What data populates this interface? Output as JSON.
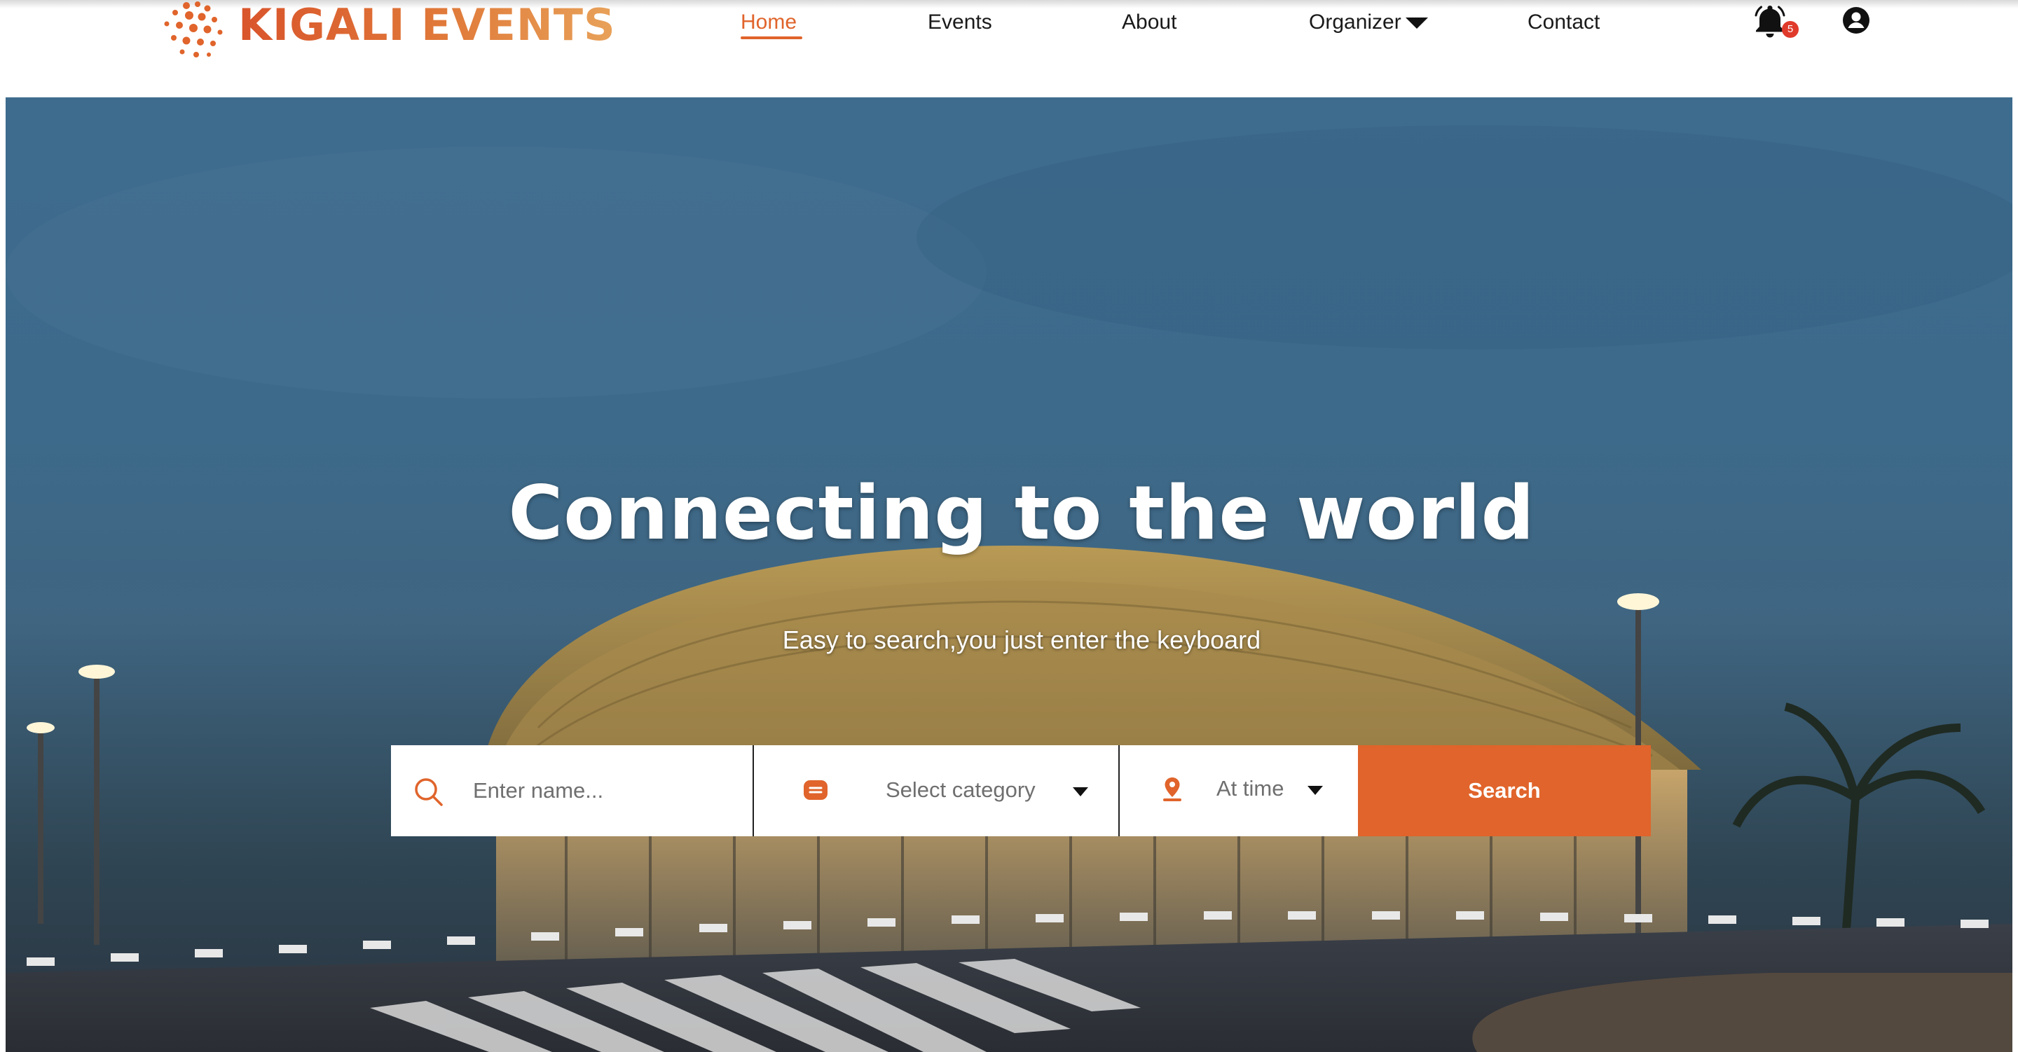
{
  "brand": {
    "name": "KIGALI EVENTS",
    "accent": "#e0642b"
  },
  "nav": {
    "items": [
      {
        "label": "Home",
        "active": true
      },
      {
        "label": "Events",
        "active": false
      },
      {
        "label": "About",
        "active": false
      },
      {
        "label": "Organizer",
        "active": false,
        "has_dropdown": true
      },
      {
        "label": "Contact",
        "active": false
      }
    ],
    "notifications": {
      "icon": "bell-icon",
      "count": "5"
    },
    "account": {
      "icon": "user-circle-icon"
    }
  },
  "hero": {
    "title": "Connecting to the world",
    "subtitle": "Easy to search,you just enter the keyboard"
  },
  "search": {
    "name_placeholder": "Enter name...",
    "name_icon": "search-icon",
    "category_label": "Select category",
    "category_icon": "category-icon",
    "time_label": "At time",
    "time_icon": "location-pin-icon",
    "button_label": "Search"
  }
}
